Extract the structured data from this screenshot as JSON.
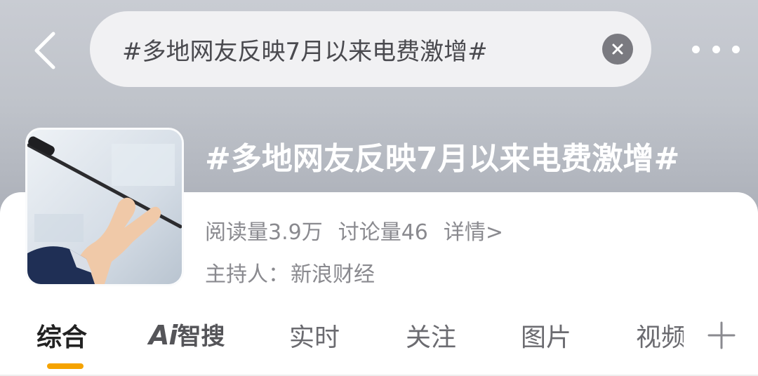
{
  "search": {
    "query": "#多地网友反映7月以来电费激增#"
  },
  "topic": {
    "title": "#多地网友反映7月以来电费激增#",
    "reads_label": "阅读量3.9万",
    "discussion_label": "讨论量46",
    "details_label": "详情>",
    "host_label": "主持人：",
    "host_name": "新浪财经"
  },
  "tabs": [
    {
      "label": "综合"
    },
    {
      "label": "智搜",
      "prefix": "Ai"
    },
    {
      "label": "实时"
    },
    {
      "label": "关注"
    },
    {
      "label": "图片"
    },
    {
      "label": "视频"
    }
  ],
  "icons": {
    "back": "back-chevron-icon",
    "clear": "clear-icon",
    "more": "more-dots-icon",
    "add": "plus-icon"
  },
  "colors": {
    "accent": "#f5a300",
    "header_bg": "#bfc3ca",
    "text_muted": "#8a8a8f"
  }
}
